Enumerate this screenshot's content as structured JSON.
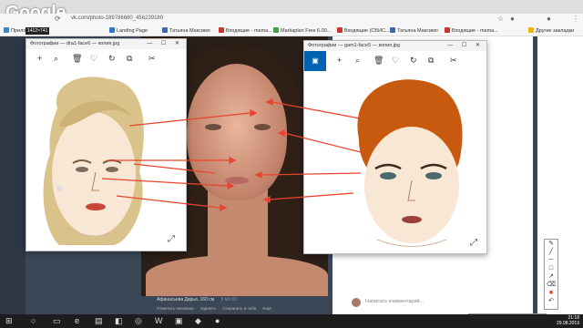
{
  "browser": {
    "logo": "Google",
    "url_text": "vk.com/photo-189786680_456239180",
    "bookmarks": [
      {
        "label": "Прило...",
        "color": "#3a87c8"
      },
      {
        "label": "Landing Page",
        "color": "#2b7bd6"
      },
      {
        "label": "Татьяна Максимо",
        "color": "#3f66a8"
      },
      {
        "label": "Входящие - mama...",
        "color": "#cc3333"
      },
      {
        "label": "Markaplan Free 6.00...",
        "color": "#43a047"
      },
      {
        "label": "Входящие (СБИС...",
        "color": "#cc3333"
      },
      {
        "label": "Татьяна Максимо",
        "color": "#3f66a8"
      },
      {
        "label": "Входящие - mama...",
        "color": "#cc3333"
      },
      {
        "label": "Другие закладки",
        "color": "#f4b400"
      }
    ]
  },
  "dimension_badge": "1412×741",
  "left_window": {
    "title": "Фотографии — dra1-face6 — копия.jpg",
    "controls": "— ☐ ✕"
  },
  "right_window": {
    "title": "Фотографии — gam1-face5 — копия.jpg",
    "controls": "— ☐ ✕"
  },
  "toolbar_icons": [
    "plus-icon",
    "zoom-icon",
    "delete-icon",
    "heart-icon",
    "rotate-icon",
    "crop-icon",
    "edit-icon"
  ],
  "post": {
    "caption": "Афанасьева Дарья, 160 см",
    "caption_meta": "5 мл 03",
    "actions": [
      "Отметить человека",
      "Удалить",
      "Сохранить в себе",
      "Ещё"
    ],
    "comment_placeholder": "Написать комментарий..."
  },
  "clock": {
    "time": "21:18",
    "date": "29.08.2019"
  },
  "colors": {
    "accent_blue": "#0063b1",
    "arrow_red": "#e8452e"
  }
}
